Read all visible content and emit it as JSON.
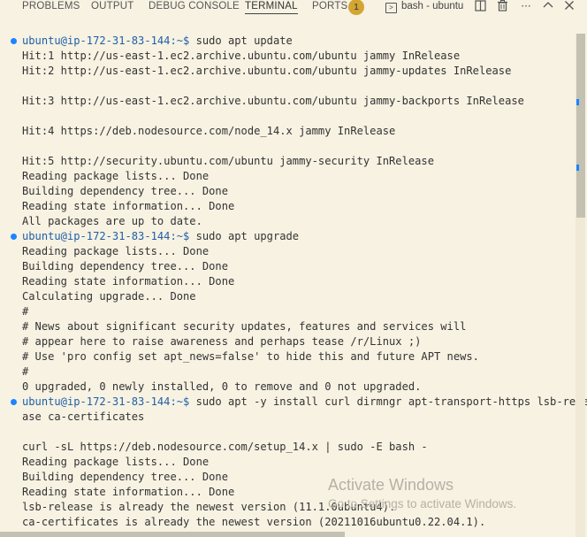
{
  "panel": {
    "tabs": [
      "PROBLEMS",
      "OUTPUT",
      "DEBUG CONSOLE",
      "TERMINAL",
      "PORTS"
    ],
    "ports_badge": "1",
    "terminal_name": "bash - ubuntu"
  },
  "icons": {
    "split": "split-terminal-icon",
    "trash": "trash-icon",
    "more": "more-actions-icon",
    "maximize": "chevron-up-icon",
    "close": "close-icon"
  },
  "terminal_lines": [
    {
      "prompt": "ubuntu@ip-172-31-83-144:~$ ",
      "text": "sudo apt update",
      "dot": true
    },
    {
      "text": "Hit:1 http://us-east-1.ec2.archive.ubuntu.com/ubuntu jammy InRelease"
    },
    {
      "text": "Hit:2 http://us-east-1.ec2.archive.ubuntu.com/ubuntu jammy-updates InRelease"
    },
    {
      "text": ""
    },
    {
      "text": "Hit:3 http://us-east-1.ec2.archive.ubuntu.com/ubuntu jammy-backports InRelease"
    },
    {
      "text": ""
    },
    {
      "text": "Hit:4 https://deb.nodesource.com/node_14.x jammy InRelease"
    },
    {
      "text": ""
    },
    {
      "text": "Hit:5 http://security.ubuntu.com/ubuntu jammy-security InRelease"
    },
    {
      "text": "Reading package lists... Done"
    },
    {
      "text": "Building dependency tree... Done"
    },
    {
      "text": "Reading state information... Done"
    },
    {
      "text": "All packages are up to date."
    },
    {
      "prompt": "ubuntu@ip-172-31-83-144:~$ ",
      "text": "sudo apt upgrade",
      "dot": true
    },
    {
      "text": "Reading package lists... Done"
    },
    {
      "text": "Building dependency tree... Done"
    },
    {
      "text": "Reading state information... Done"
    },
    {
      "text": "Calculating upgrade... Done"
    },
    {
      "text": "#"
    },
    {
      "text": "# News about significant security updates, features and services will"
    },
    {
      "text": "# appear here to raise awareness and perhaps tease /r/Linux ;)"
    },
    {
      "text": "# Use 'pro config set apt_news=false' to hide this and future APT news."
    },
    {
      "text": "#"
    },
    {
      "text": "0 upgraded, 0 newly installed, 0 to remove and 0 not upgraded."
    },
    {
      "prompt": "ubuntu@ip-172-31-83-144:~$ ",
      "text": "sudo apt -y install curl dirmngr apt-transport-https lsb-rele",
      "dot": true
    },
    {
      "text": "ase ca-certificates"
    },
    {
      "text": ""
    },
    {
      "text": "curl -sL https://deb.nodesource.com/setup_14.x | sudo -E bash -"
    },
    {
      "text": "Reading package lists... Done"
    },
    {
      "text": "Building dependency tree... Done"
    },
    {
      "text": "Reading state information... Done"
    },
    {
      "text": "lsb-release is already the newest version (11.1.0ubuntu4)."
    },
    {
      "text": "ca-certificates is already the newest version (20211016ubuntu0.22.04.1)."
    }
  ],
  "watermark": {
    "title": "Activate Windows",
    "subtitle": "Go to Settings to activate Windows."
  },
  "colors": {
    "background": "#f7f2e2",
    "prompt": "#1f5fa8",
    "command_dot": "#1a85ff",
    "badge": "#d3a532"
  }
}
